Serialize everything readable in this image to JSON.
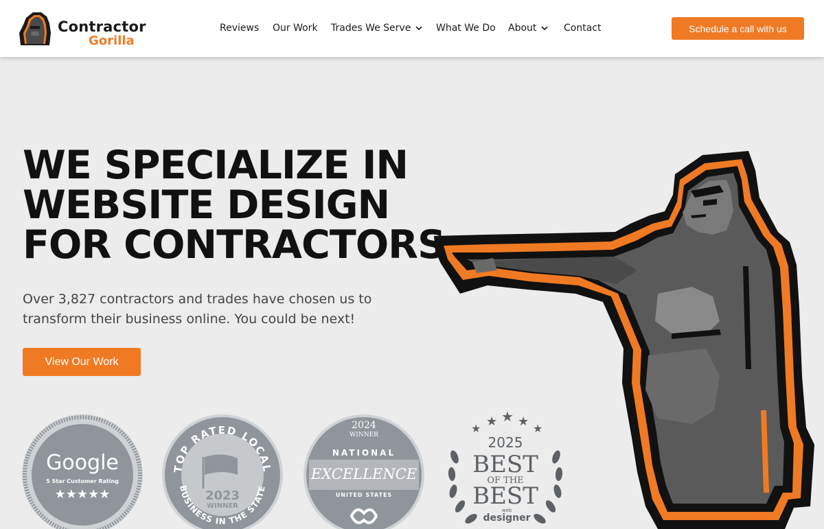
{
  "header": {
    "logo": {
      "line1": "Contractor",
      "line2": "Gorilla"
    },
    "nav": [
      {
        "label": "Reviews",
        "has_dropdown": false
      },
      {
        "label": "Our Work",
        "has_dropdown": false
      },
      {
        "label": "Trades We Serve",
        "has_dropdown": true
      },
      {
        "label": "What We Do",
        "has_dropdown": false
      },
      {
        "label": "About",
        "has_dropdown": true
      },
      {
        "label": "Contact",
        "has_dropdown": false
      }
    ],
    "cta_label": "Schedule a call with us"
  },
  "hero": {
    "headline": [
      "WE SPECIALIZE IN",
      "WEBSITE DESIGN",
      "FOR CONTRACTORS"
    ],
    "subtext": "Over 3,827 contractors and trades have chosen us to transform their business online. You could be next!",
    "cta_label": "View Our Work"
  },
  "badges": {
    "google": {
      "brand": "Google",
      "caption": "5 Star Customer Rating",
      "stars": "★★★★★"
    },
    "top_rated": {
      "arc_top": "TOP RATED LOCAL",
      "year": "2023",
      "label": "WINNER",
      "arc_bottom": "BUSINESS IN THE STATE"
    },
    "national": {
      "year": "2024",
      "label": "WINNER",
      "title": "NATIONAL",
      "main": "EXCELLENCE",
      "sub": "UNITED STATES"
    },
    "best": {
      "year": "2025",
      "line1": "BEST",
      "line2": "OF THE",
      "line3": "BEST",
      "brand_small": "web",
      "brand": "designer"
    }
  },
  "colors": {
    "accent": "#f07a24",
    "text": "#111111",
    "background": "#ececec",
    "badge_gray": "#8f959b"
  },
  "icons": [
    "gorilla-logo-icon",
    "chevron-down-icon",
    "gorilla-illustration",
    "star-icon",
    "laurel-icon"
  ]
}
